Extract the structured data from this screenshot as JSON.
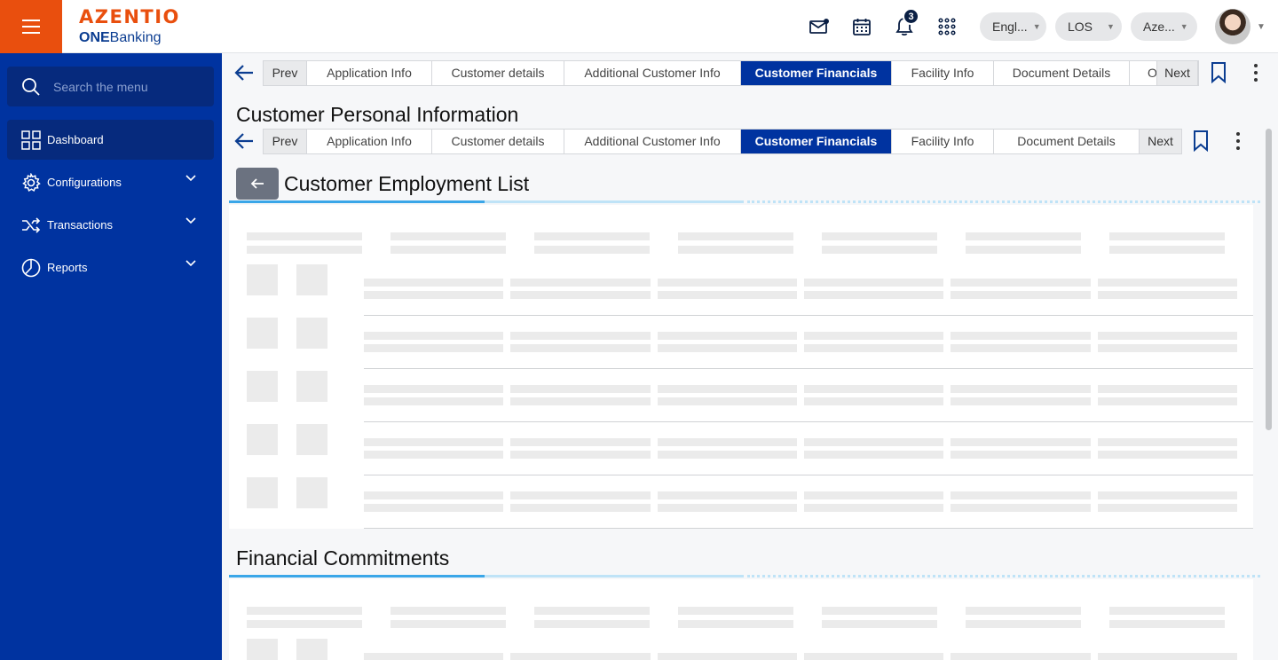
{
  "header": {
    "logo_main": "AZENTIO",
    "logo_sub_bold": "ONE",
    "logo_sub_rest": "Banking",
    "notification_count": "3",
    "language_label": "Engl...",
    "module_label": "LOS",
    "entity_label": "Aze..."
  },
  "sidebar": {
    "search_placeholder": "Search the menu",
    "items": [
      {
        "label": "Dashboard"
      },
      {
        "label": "Configurations"
      },
      {
        "label": "Transactions"
      },
      {
        "label": "Reports"
      }
    ]
  },
  "outer_tabs": {
    "prev": "Prev",
    "items": [
      {
        "label": "Application Info"
      },
      {
        "label": "Customer details"
      },
      {
        "label": "Additional Customer Info"
      },
      {
        "label": "Customer Financials"
      },
      {
        "label": "Facility Info"
      },
      {
        "label": "Document Details"
      },
      {
        "label": "O"
      }
    ],
    "next": "Next"
  },
  "page_title": "Customer Personal Information",
  "inner_tabs": {
    "prev": "Prev",
    "items": [
      {
        "label": "Application Info"
      },
      {
        "label": "Customer details"
      },
      {
        "label": "Additional Customer Info"
      },
      {
        "label": "Customer Financials"
      },
      {
        "label": "Facility Info"
      },
      {
        "label": "Document Details"
      }
    ],
    "next": "Next"
  },
  "sections": {
    "employment_title": "Customer Employment List",
    "commitments_title": "Financial Commitments"
  },
  "icons": {
    "menu": "hamburger-icon",
    "mail": "mail-icon",
    "calendar": "calendar-icon",
    "bell": "bell-icon",
    "apps": "apps-grid-icon",
    "search": "search-icon",
    "dashboard": "dashboard-grid-icon",
    "configurations": "gear-icon",
    "transactions": "shuffle-icon",
    "reports": "pie-chart-icon",
    "back": "arrow-left-icon",
    "bookmark": "bookmark-icon",
    "more": "kebab-icon"
  },
  "colors": {
    "brand_orange": "#e94f0e",
    "sidebar_blue": "#0033a0",
    "active_tab": "#0033a0",
    "accent_underline": "#3aa6e8"
  }
}
